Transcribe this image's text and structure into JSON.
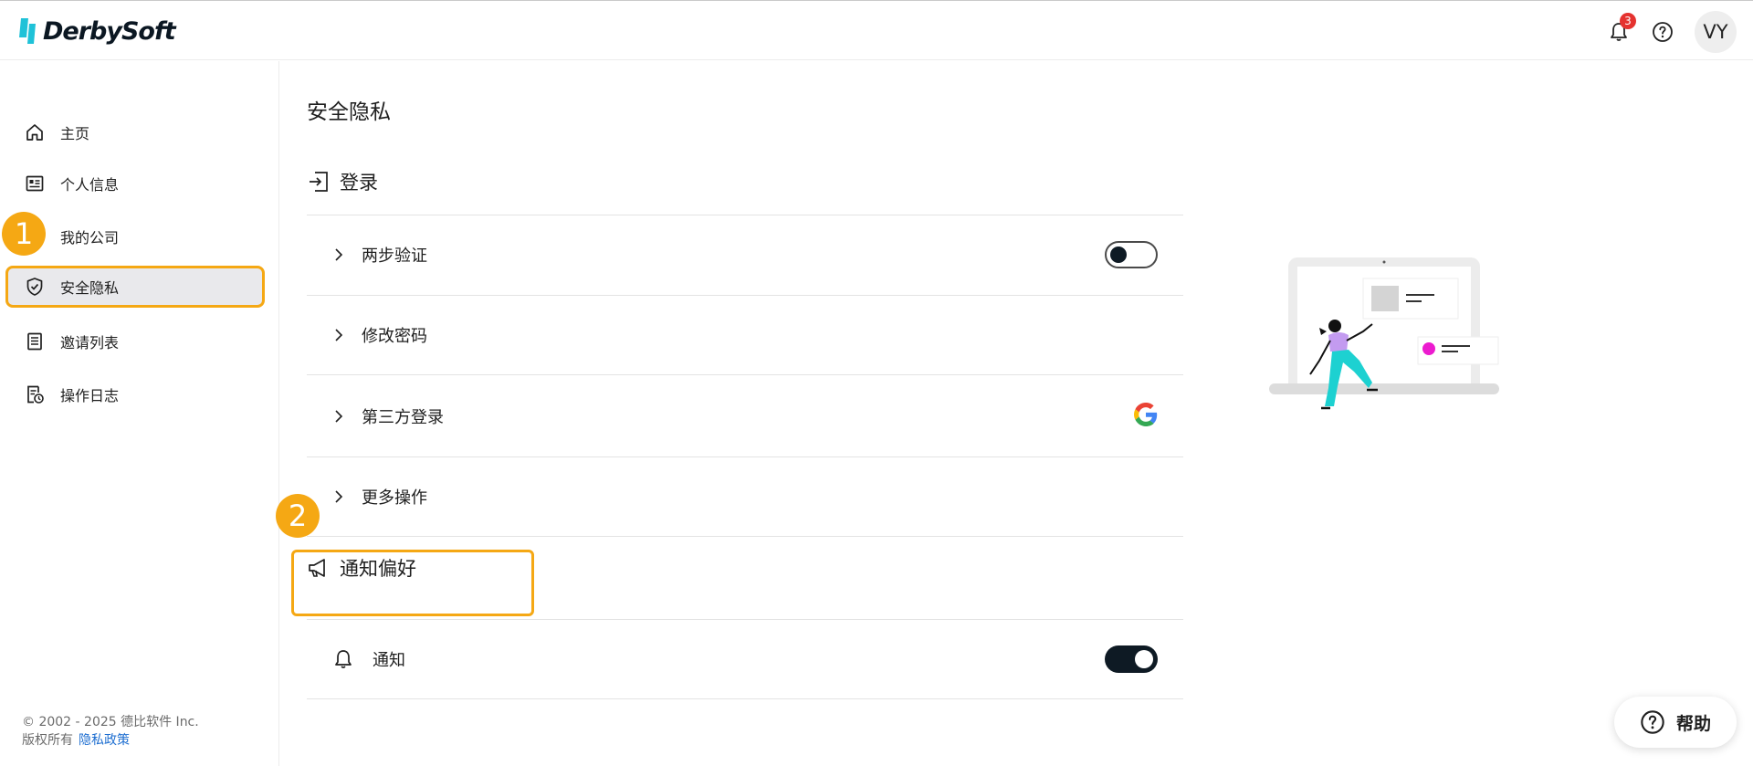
{
  "brand": {
    "name": "DerbySoft",
    "accent": "#1fc2d8"
  },
  "header": {
    "notification_count": "3",
    "avatar_initials": "VY"
  },
  "sidebar": {
    "items": [
      {
        "label": "主页",
        "icon": "home-icon"
      },
      {
        "label": "个人信息",
        "icon": "id-card-icon"
      },
      {
        "label": "我的公司",
        "icon": "company-icon"
      },
      {
        "label": "安全隐私",
        "icon": "shield-check-icon",
        "active": true
      },
      {
        "label": "邀请列表",
        "icon": "document-list-icon"
      },
      {
        "label": "操作日志",
        "icon": "log-clock-icon"
      }
    ],
    "footer": {
      "copyright": "© 2002 - 2025 德比软件 Inc.",
      "rights": "版权所有",
      "privacy_link": "隐私政策"
    }
  },
  "markers": [
    "1",
    "2"
  ],
  "main": {
    "title": "安全隐私",
    "login_section": {
      "title": "登录",
      "rows": [
        {
          "label": "两步验证",
          "toggle": "off"
        },
        {
          "label": "修改密码"
        },
        {
          "label": "第三方登录",
          "icon": "google-icon"
        },
        {
          "label": "更多操作"
        }
      ]
    },
    "notify_section": {
      "title": "通知偏好",
      "rows": [
        {
          "label": "通知",
          "toggle": "on"
        }
      ]
    }
  },
  "help_button": {
    "label": "帮助"
  },
  "colors": {
    "highlight": "#f5a814",
    "active_bg": "#e9e9ec",
    "link": "#1f6fd1",
    "badge": "#e5322f"
  }
}
